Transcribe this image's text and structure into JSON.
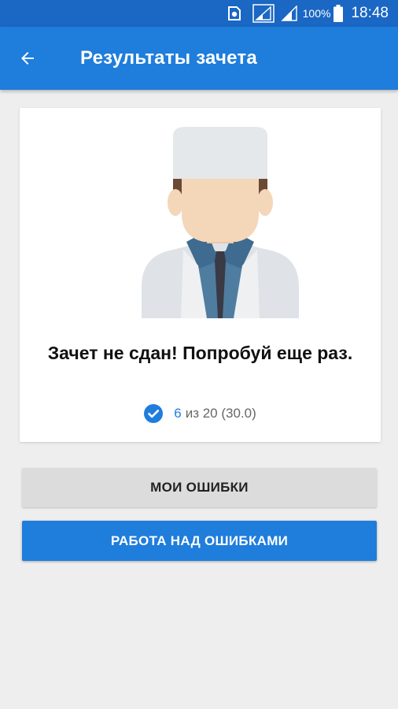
{
  "status_bar": {
    "battery_percent": "100%",
    "time": "18:48",
    "icons": [
      "sim-icon",
      "signal-icon",
      "signal-icon",
      "battery-icon"
    ]
  },
  "app_bar": {
    "title": "Результаты зачета",
    "back_icon": "arrow-back-icon"
  },
  "result": {
    "message": "Зачет не сдан! Попробуй еще раз.",
    "correct": "6",
    "score_rest": "из 20 (30.0)",
    "check_icon": "check-circle-icon"
  },
  "buttons": {
    "my_mistakes": "МОИ ОШИБКИ",
    "work_on_mistakes": "РАБОТА НАД ОШИБКАМИ"
  },
  "colors": {
    "status_bar": "#1a67c4",
    "primary": "#1f7ddc",
    "background": "#eeeeee",
    "secondary_button": "#dcdcdc"
  }
}
